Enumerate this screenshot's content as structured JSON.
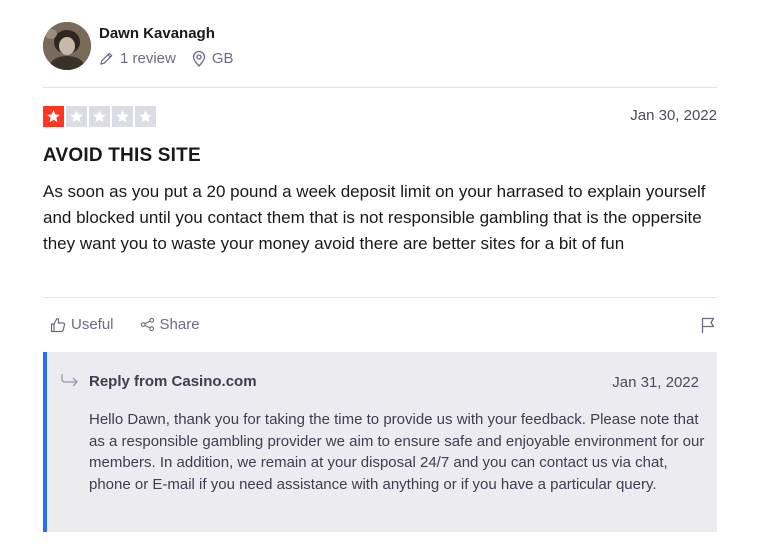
{
  "reviewer": {
    "name": "Dawn Kavanagh",
    "reviews_count": "1 review",
    "country": "GB"
  },
  "review": {
    "rating": 1,
    "max_rating": 5,
    "date": "Jan 30, 2022",
    "title": "AVOID THIS SITE",
    "body": "As soon as you put a 20 pound a week deposit limit on your harrased to explain yourself and blocked until you contact them that is not responsible gambling that is the oppersite they want you to waste your money avoid there are better sites for a bit of fun"
  },
  "actions": {
    "useful_label": "Useful",
    "share_label": "Share"
  },
  "reply": {
    "label": "Reply from Casino.com",
    "date": "Jan 31, 2022",
    "body": "Hello Dawn, thank you for taking the time to provide us with your feedback. Please note that as a responsible gambling provider we aim to ensure safe and enjoyable environment for our members. In addition, we remain at your disposal 24/7 and you can contact us via chat, phone or E-mail if you need assistance with anything or if you have a particular query."
  },
  "colors": {
    "star_filled": "#ff3722",
    "star_empty": "#dcdce6",
    "reply_accent": "#2a6bff",
    "reply_background": "#ebebf0"
  }
}
